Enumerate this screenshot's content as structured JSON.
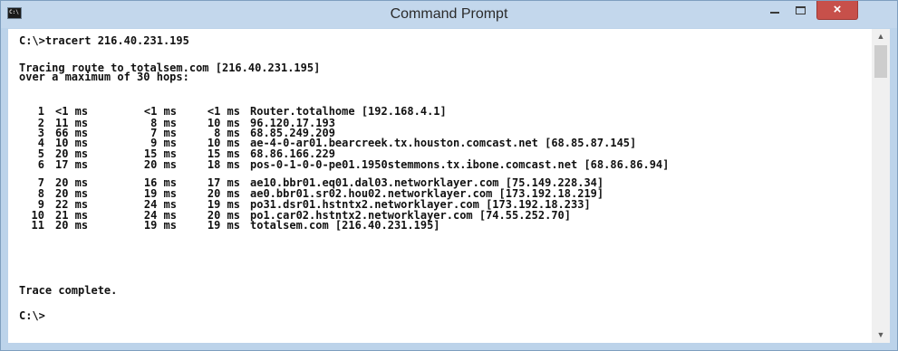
{
  "window": {
    "title": "Command Prompt",
    "icon_text": "C:\\"
  },
  "console": {
    "command": "C:\\>tracert 216.40.231.195",
    "tracing_line": "Tracing route to totalsem.com [216.40.231.195]",
    "hops_line": "over a maximum of 30 hops:",
    "hops": [
      {
        "n": "1",
        "t1": "<1 ms",
        "t2": "<1 ms",
        "t3": "<1 ms",
        "host": "Router.totalhome [192.168.4.1]"
      },
      {
        "n": "2",
        "t1": "11 ms",
        "t2": "8 ms",
        "t3": "10 ms",
        "host": "96.120.17.193"
      },
      {
        "n": "3",
        "t1": "66 ms",
        "t2": "7 ms",
        "t3": "8 ms",
        "host": "68.85.249.209"
      },
      {
        "n": "4",
        "t1": "10 ms",
        "t2": "9 ms",
        "t3": "10 ms",
        "host": "ae-4-0-ar01.bearcreek.tx.houston.comcast.net [68.85.87.145]"
      },
      {
        "n": "5",
        "t1": "20 ms",
        "t2": "15 ms",
        "t3": "15 ms",
        "host": "68.86.166.229"
      },
      {
        "n": "6",
        "t1": "17 ms",
        "t2": "20 ms",
        "t3": "18 ms",
        "host": "pos-0-1-0-0-pe01.1950stemmons.tx.ibone.comcast.net [68.86.86.94]"
      },
      {
        "n": "7",
        "t1": "20 ms",
        "t2": "16 ms",
        "t3": "17 ms",
        "host": "ae10.bbr01.eq01.dal03.networklayer.com [75.149.228.34]"
      },
      {
        "n": "8",
        "t1": "20 ms",
        "t2": "19 ms",
        "t3": "20 ms",
        "host": "ae0.bbr01.sr02.hou02.networklayer.com [173.192.18.219]"
      },
      {
        "n": "9",
        "t1": "22 ms",
        "t2": "24 ms",
        "t3": "19 ms",
        "host": "po31.dsr01.hstntx2.networklayer.com [173.192.18.233]"
      },
      {
        "n": "10",
        "t1": "21 ms",
        "t2": "24 ms",
        "t3": "20 ms",
        "host": "po1.car02.hstntx2.networklayer.com [74.55.252.70]"
      },
      {
        "n": "11",
        "t1": "20 ms",
        "t2": "19 ms",
        "t3": "19 ms",
        "host": "totalsem.com [216.40.231.195]"
      }
    ],
    "complete_line": "Trace complete.",
    "prompt": "C:\\>"
  },
  "controls": {
    "minimize": "–",
    "maximize": "□",
    "close": "×"
  },
  "scrollbar": {
    "up": "▲",
    "down": "▼"
  },
  "colors": {
    "titlebar": "#c3d7ec",
    "close": "#c7504a",
    "text": "#111111"
  }
}
